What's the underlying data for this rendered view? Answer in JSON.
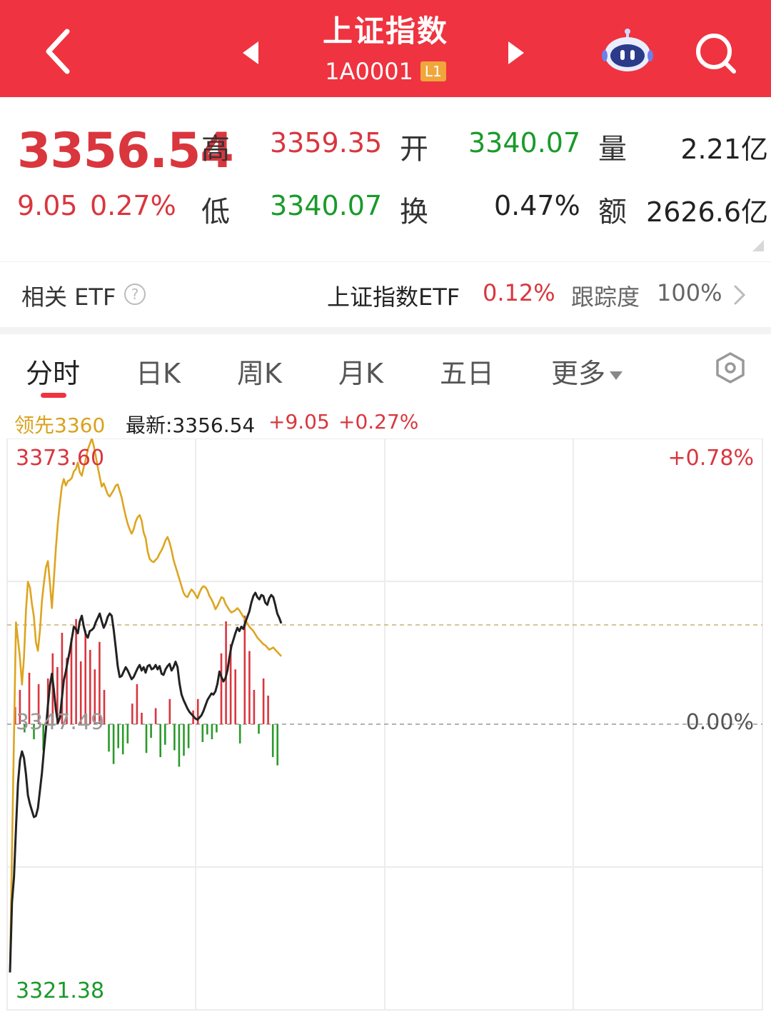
{
  "header": {
    "title": "上证指数",
    "code": "1A0001",
    "level_badge": "L1",
    "bg_color": "#ef3340"
  },
  "icons": {
    "back": "chevron-left-icon",
    "prev": "triangle-left-icon",
    "next": "triangle-right-icon",
    "robot": "robot-assistant-icon",
    "search": "search-icon",
    "help": "question-circle-icon",
    "more": "chevron-right-icon",
    "settings": "hexagon-settings-icon"
  },
  "quote": {
    "price": "3356.54",
    "change": "9.05",
    "change_pct": "0.27%",
    "high_label": "高",
    "high": "3359.35",
    "low_label": "低",
    "low": "3340.07",
    "open_label": "开",
    "open": "3340.07",
    "turnover_label": "换",
    "turnover": "0.47%",
    "volume_label": "量",
    "volume": "2.21亿",
    "amount_label": "额",
    "amount": "2626.6亿"
  },
  "etf": {
    "label": "相关 ETF",
    "help_glyph": "?",
    "name": "上证指数ETF",
    "pct": "0.12%",
    "tracking_label": "跟踪度",
    "tracking": "100%"
  },
  "tabs": [
    "分时",
    "日K",
    "周K",
    "月K",
    "五日",
    "更多"
  ],
  "info_line": {
    "leading": "领先3360",
    "latest": "最新:3356.54",
    "change": "+9.05",
    "change_pct": "+0.27%"
  },
  "chart_data": {
    "type": "line",
    "y_max_label": "3373.60",
    "y_min_label": "3321.38",
    "y_mid_label": "3347.49",
    "pct_max_label": "+0.78%",
    "pct_mid_label": "0.00%",
    "ylim": [
      3321.38,
      3373.6
    ],
    "prev_close": 3347.49,
    "time_points_total": 240,
    "series": [
      {
        "key": "price",
        "color": "#222222",
        "values": [
          3324.8,
          3331.2,
          3333.5,
          3338.0,
          3342.1,
          3344.2,
          3345.0,
          3344.4,
          3342.9,
          3341.0,
          3340.2,
          3339.6,
          3339.0,
          3339.1,
          3339.8,
          3341.4,
          3343.0,
          3345.1,
          3347.0,
          3349.2,
          3351.0,
          3352.1,
          3350.6,
          3348.8,
          3347.6,
          3348.1,
          3349.8,
          3351.5,
          3352.3,
          3353.3,
          3354.2,
          3355.3,
          3356.4,
          3356.2,
          3355.8,
          3356.9,
          3357.4,
          3356.4,
          3355.7,
          3355.4,
          3356.0,
          3356.1,
          3356.3,
          3356.8,
          3357.2,
          3357.6,
          3356.9,
          3356.3,
          3356.7,
          3357.3,
          3357.6,
          3357.4,
          3356.1,
          3354.5,
          3352.8,
          3351.8,
          3351.9,
          3352.3,
          3352.7,
          3352.4,
          3352.0,
          3351.6,
          3351.8,
          3352.2,
          3352.6,
          3352.9,
          3352.4,
          3352.7,
          3352.2,
          3352.8,
          3352.9,
          3352.5,
          3352.6,
          3352.9,
          3352.5,
          3352.8,
          3352.1,
          3352.0,
          3352.5,
          3352.8,
          3353.0,
          3352.4,
          3352.7,
          3353.2,
          3352.7,
          3351.2,
          3350.2,
          3349.7,
          3349.3,
          3348.9,
          3348.6,
          3348.4,
          3348.2,
          3348.0,
          3347.9,
          3348.1,
          3348.3,
          3348.7,
          3349.2,
          3349.7,
          3350.0,
          3350.3,
          3350.2,
          3350.5,
          3351.2,
          3352.3,
          3351.8,
          3351.4,
          3351.7,
          3352.4,
          3353.6,
          3354.6,
          3355.2,
          3355.8,
          3356.3,
          3356.0,
          3356.4,
          3356.2,
          3356.8,
          3357.3,
          3357.8,
          3358.6,
          3359.2,
          3359.5,
          3359.1,
          3358.9,
          3359.3,
          3359.2,
          3358.6,
          3358.4,
          3359.0,
          3359.3,
          3359.1,
          3358.4,
          3357.6,
          3357.2,
          3356.7
        ]
      },
      {
        "key": "leading",
        "color": "#dda520",
        "values": [
          3324.8,
          3336.0,
          3346.4,
          3356.8,
          3355.2,
          3353.5,
          3351.1,
          3353.6,
          3357.9,
          3360.5,
          3360.0,
          3358.5,
          3357.3,
          3355.0,
          3354.2,
          3356.0,
          3358.7,
          3360.4,
          3361.8,
          3362.4,
          3360.4,
          3358.1,
          3360.8,
          3363.6,
          3365.9,
          3367.7,
          3369.2,
          3369.9,
          3369.3,
          3369.7,
          3369.8,
          3370.0,
          3370.6,
          3370.8,
          3371.4,
          3370.5,
          3370.2,
          3371.0,
          3371.7,
          3372.6,
          3373.1,
          3373.6,
          3372.9,
          3372.0,
          3371.0,
          3370.1,
          3369.2,
          3369.5,
          3369.0,
          3368.5,
          3368.3,
          3368.6,
          3368.9,
          3369.3,
          3369.4,
          3368.8,
          3368.2,
          3367.3,
          3366.5,
          3365.8,
          3365.3,
          3364.9,
          3365.3,
          3366.0,
          3366.4,
          3366.6,
          3366.1,
          3365.0,
          3364.5,
          3363.3,
          3362.6,
          3362.4,
          3362.3,
          3362.5,
          3362.7,
          3363.1,
          3363.4,
          3363.8,
          3364.3,
          3364.6,
          3364.1,
          3363.4,
          3362.5,
          3361.9,
          3361.3,
          3360.7,
          3360.1,
          3359.5,
          3359.2,
          3359.1,
          3359.5,
          3359.8,
          3359.6,
          3359.3,
          3359.0,
          3359.5,
          3359.9,
          3360.1,
          3360.0,
          3359.7,
          3359.2,
          3358.9,
          3358.5,
          3358.0,
          3358.3,
          3358.7,
          3359.1,
          3359.0,
          3358.5,
          3358.2,
          3357.9,
          3357.7,
          3357.8,
          3357.9,
          3358.1,
          3357.9,
          3357.6,
          3357.3,
          3357.0,
          3356.7,
          3356.4,
          3356.2,
          3356.0,
          3355.7,
          3355.4,
          3355.2,
          3355.0,
          3354.8,
          3354.7,
          3354.5,
          3354.3,
          3354.4,
          3354.5,
          3354.3,
          3354.1,
          3353.9,
          3353.7
        ]
      }
    ],
    "volume_bars": [
      {
        "dir": "up",
        "v": 0.15
      },
      {
        "dir": "up",
        "v": 0.3
      },
      {
        "dir": "down",
        "v": 0.12
      },
      {
        "dir": "up",
        "v": 0.45
      },
      {
        "dir": "down",
        "v": 0.22
      },
      {
        "dir": "up",
        "v": 0.35
      },
      {
        "dir": "down",
        "v": 0.38
      },
      {
        "dir": "up",
        "v": 0.4
      },
      {
        "dir": "up",
        "v": 0.62
      },
      {
        "dir": "up",
        "v": 0.5
      },
      {
        "dir": "up",
        "v": 0.8
      },
      {
        "dir": "up",
        "v": 0.58
      },
      {
        "dir": "up",
        "v": 0.75
      },
      {
        "dir": "up",
        "v": 0.92
      },
      {
        "dir": "up",
        "v": 0.55
      },
      {
        "dir": "up",
        "v": 0.82
      },
      {
        "dir": "up",
        "v": 0.65
      },
      {
        "dir": "up",
        "v": 0.48
      },
      {
        "dir": "up",
        "v": 0.72
      },
      {
        "dir": "up",
        "v": 0.3
      },
      {
        "dir": "down",
        "v": 0.4
      },
      {
        "dir": "down",
        "v": 0.58
      },
      {
        "dir": "down",
        "v": 0.35
      },
      {
        "dir": "down",
        "v": 0.44
      },
      {
        "dir": "down",
        "v": 0.28
      },
      {
        "dir": "up",
        "v": 0.18
      },
      {
        "dir": "up",
        "v": 0.35
      },
      {
        "dir": "up",
        "v": 0.1
      },
      {
        "dir": "down",
        "v": 0.42
      },
      {
        "dir": "down",
        "v": 0.2
      },
      {
        "dir": "up",
        "v": 0.14
      },
      {
        "dir": "down",
        "v": 0.48
      },
      {
        "dir": "down",
        "v": 0.3
      },
      {
        "dir": "up",
        "v": 0.22
      },
      {
        "dir": "down",
        "v": 0.38
      },
      {
        "dir": "down",
        "v": 0.62
      },
      {
        "dir": "down",
        "v": 0.46
      },
      {
        "dir": "down",
        "v": 0.35
      },
      {
        "dir": "up",
        "v": 0.12
      },
      {
        "dir": "up",
        "v": 0.22
      },
      {
        "dir": "down",
        "v": 0.26
      },
      {
        "dir": "down",
        "v": 0.15
      },
      {
        "dir": "down",
        "v": 0.22
      },
      {
        "dir": "down",
        "v": 0.12
      },
      {
        "dir": "up",
        "v": 0.62
      },
      {
        "dir": "up",
        "v": 0.9
      },
      {
        "dir": "up",
        "v": 0.7
      },
      {
        "dir": "up",
        "v": 0.48
      },
      {
        "dir": "down",
        "v": 0.28
      },
      {
        "dir": "up",
        "v": 0.95
      },
      {
        "dir": "up",
        "v": 0.64
      },
      {
        "dir": "up",
        "v": 0.3
      },
      {
        "dir": "down",
        "v": 0.14
      },
      {
        "dir": "up",
        "v": 0.4
      },
      {
        "dir": "up",
        "v": 0.25
      },
      {
        "dir": "down",
        "v": 0.48
      },
      {
        "dir": "down",
        "v": 0.6
      }
    ]
  }
}
